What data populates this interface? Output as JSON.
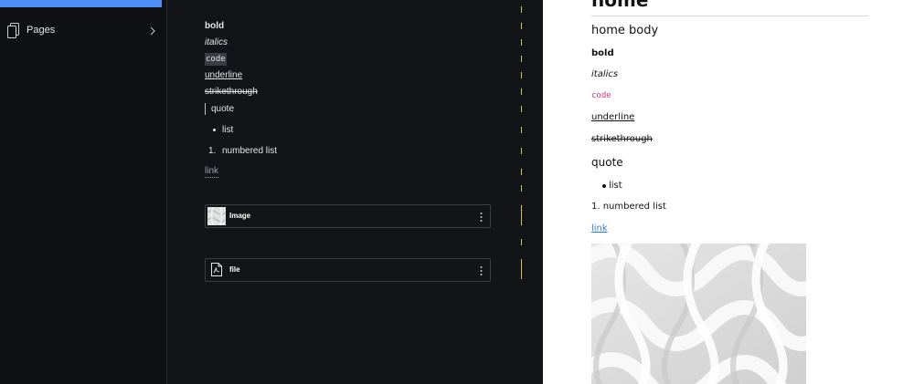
{
  "sidebar": {
    "items": [
      {
        "label": "Pages",
        "icon": "pages-icon"
      }
    ],
    "accent_color": "#4f8ef7"
  },
  "editor": {
    "bold": "bold",
    "italics": "italics",
    "code": "code",
    "underline": "underline",
    "strikethrough": "strikethrough",
    "quote": "quote",
    "list_item": "list",
    "numbered_marker": "1.",
    "numbered_item": "numbered list",
    "link": "link",
    "image_block": {
      "name": "Image"
    },
    "file_block": {
      "name": "file"
    }
  },
  "preview": {
    "title": "home",
    "heading": "home body",
    "bold": "bold",
    "italics": "italics",
    "code": "code",
    "underline": "underline",
    "strikethrough": "strikethrough",
    "quote": "quote",
    "list_item": "list",
    "numbered_item": "1. numbered list",
    "link": "link",
    "link_color": "#2a7fdc",
    "code_color": "#d63384"
  }
}
